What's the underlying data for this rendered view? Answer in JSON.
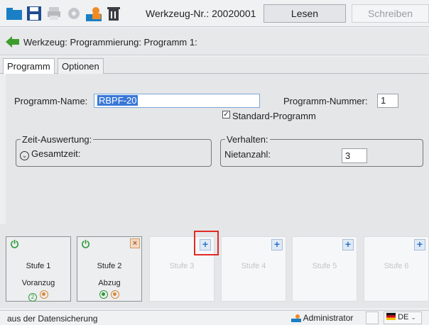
{
  "toolbar": {
    "icons": [
      "folder-icon",
      "save-icon",
      "print-icon",
      "settings-icon",
      "user-icon",
      "trash-icon"
    ],
    "werkzeug_label": "Werkzeug-Nr.: 20020001",
    "read_label": "Lesen",
    "write_label": "Schreiben"
  },
  "breadcrumb": {
    "text": "Werkzeug: Programmierung: Programm 1:"
  },
  "tabs": [
    {
      "label": "Programm",
      "active": true
    },
    {
      "label": "Optionen",
      "active": false
    }
  ],
  "program": {
    "name_label": "Programm-Name:",
    "name_value": "RBPF-20",
    "number_label": "Programm-Nummer:",
    "number_value": "1",
    "standard_label": "Standard-Programm",
    "standard_checked": true
  },
  "evaluation": {
    "title": "Zeit-Auswertung:",
    "total_label": "Gesamtzeit:"
  },
  "behavior": {
    "title": "Verhalten:",
    "rivet_label": "Nietanzahl:",
    "rivet_value": "3"
  },
  "stages": [
    {
      "name": "Stufe 1",
      "sub": "Voranzug",
      "state": "filled"
    },
    {
      "name": "Stufe 2",
      "sub": "Abzug",
      "state": "filled"
    },
    {
      "name": "Stufe 3",
      "sub": "",
      "state": "empty"
    },
    {
      "name": "Stufe 4",
      "sub": "",
      "state": "empty"
    },
    {
      "name": "Stufe 5",
      "sub": "",
      "state": "empty"
    },
    {
      "name": "Stufe 6",
      "sub": "",
      "state": "empty"
    }
  ],
  "stage1_circle_num": "2",
  "status": {
    "text": "aus der Datensicherung",
    "user": "Administrator",
    "language": "DE"
  }
}
